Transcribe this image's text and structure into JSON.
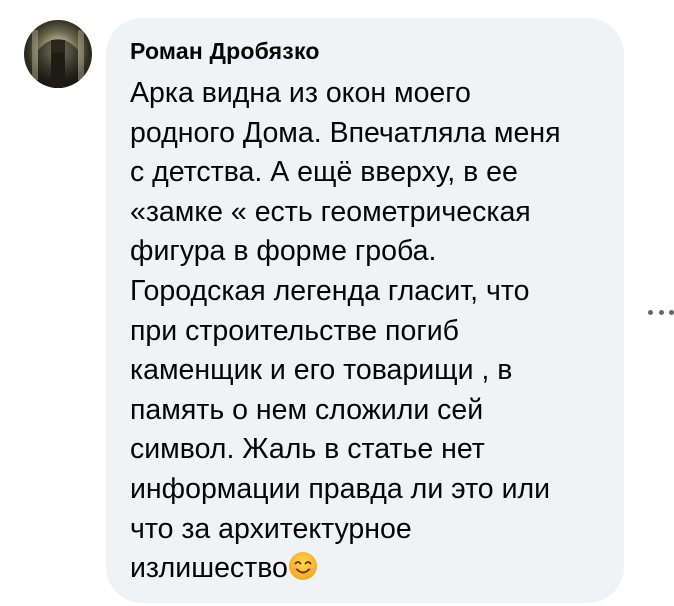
{
  "comment": {
    "author": "Роман Дробязко",
    "lines": [
      "Арка видна из окон моего",
      "родного Дома. Впечатляла меня",
      "с детства. А ещё вверху, в ее",
      "«замке « есть геометрическая",
      "фигура в форме гроба.",
      "Городская легенда гласит, что",
      "при строительстве погиб",
      "каменщик и его товарищи , в",
      "память о нем сложили сей",
      "символ. Жаль в статье нет",
      "информации правда ли это или",
      "что за архитектурное",
      "излишество"
    ],
    "emoji": "smiling-face-emoji"
  },
  "more_menu": {
    "icon": "more-horizontal-icon"
  },
  "colors": {
    "bubble": "#f0f2f5",
    "text": "#050505",
    "dots": "#65676b"
  }
}
